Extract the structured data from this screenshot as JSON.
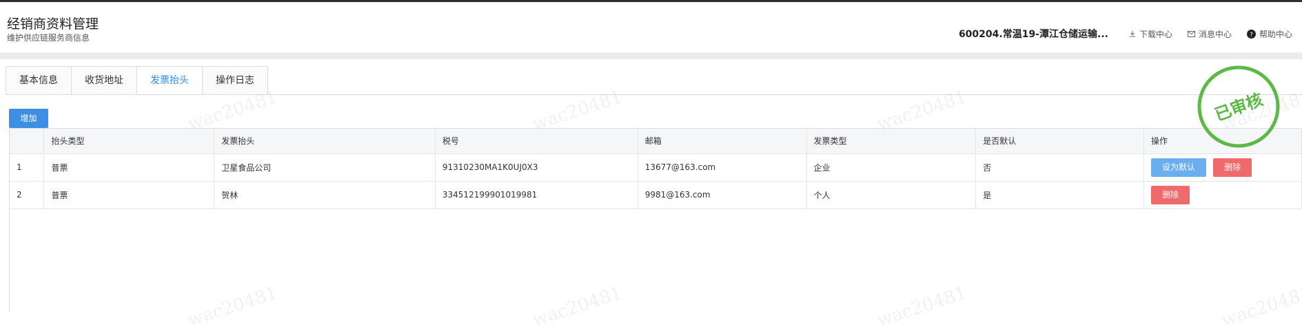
{
  "header": {
    "title": "经销商资料管理",
    "subtitle": "维护供应链服务商信息",
    "company": "600204.常温19-潭江仓储运输...",
    "download": "下载中心",
    "messages": "消息中心",
    "help": "帮助中心"
  },
  "tabs": [
    {
      "label": "基本信息"
    },
    {
      "label": "收货地址"
    },
    {
      "label": "发票抬头",
      "active": true
    },
    {
      "label": "操作日志"
    }
  ],
  "add_button": "增加",
  "table": {
    "headers": [
      "",
      "抬头类型",
      "发票抬头",
      "税号",
      "邮箱",
      "发票类型",
      "是否默认",
      "操作"
    ],
    "rows": [
      {
        "index": "1",
        "title_type": "普票",
        "invoice_title": "卫星食品公司",
        "tax_no": "91310230MA1K0UJ0X3",
        "email": "13677@163.com",
        "invoice_type": "企业",
        "is_default": "否",
        "actions": [
          "设为默认",
          "删除"
        ]
      },
      {
        "index": "2",
        "title_type": "普票",
        "invoice_title": "贺林",
        "tax_no": "334512199901019981",
        "email": "9981@163.com",
        "invoice_type": "个人",
        "is_default": "是",
        "actions": [
          "删除"
        ]
      }
    ]
  },
  "stamp_text": "已审核",
  "watermark_text": "wac20481",
  "colors": {
    "accent": "#2d8cf0",
    "primary_button": "#3d8fe3",
    "danger": "#ef6b6b",
    "stamp": "#5cb946"
  }
}
